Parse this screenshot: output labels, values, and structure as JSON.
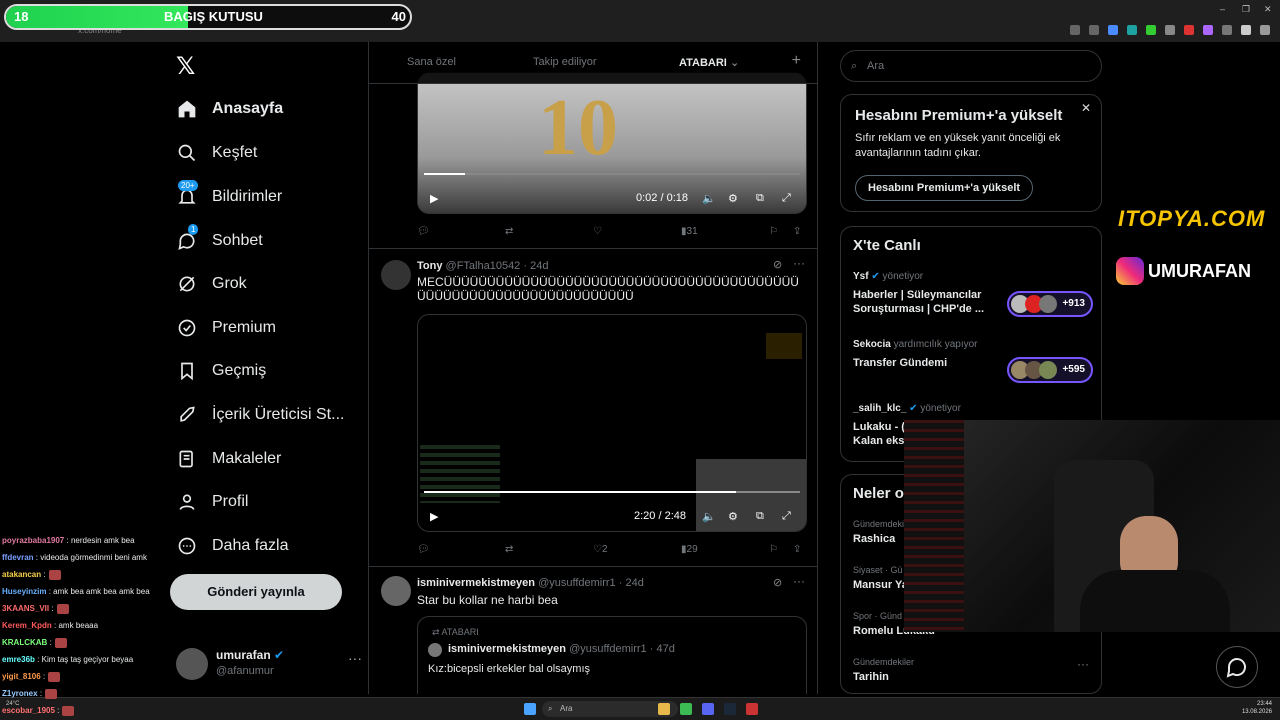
{
  "donation": {
    "left_value": "18",
    "label": "BAGIŞ KUTUSU",
    "right_value": "40",
    "progress_fraction": 0.45
  },
  "browser": {
    "url": "x.com/home"
  },
  "nav": {
    "items": [
      {
        "label": "Anasayfa",
        "icon": "home-icon"
      },
      {
        "label": "Keşfet",
        "icon": "search-icon"
      },
      {
        "label": "Bildirimler",
        "icon": "bell-icon",
        "badge": "20+"
      },
      {
        "label": "Sohbet",
        "icon": "chat-icon",
        "badge": "1"
      },
      {
        "label": "Grok",
        "icon": "grok-icon"
      },
      {
        "label": "Premium",
        "icon": "premium-icon"
      },
      {
        "label": "Geçmiş",
        "icon": "bookmark-icon"
      },
      {
        "label": "İçerik Üreticisi St...",
        "icon": "rocket-icon"
      },
      {
        "label": "Makaleler",
        "icon": "article-icon"
      },
      {
        "label": "Profil",
        "icon": "profile-icon"
      },
      {
        "label": "Daha fazla",
        "icon": "more-icon"
      }
    ],
    "post_button": "Gönderi yayınla",
    "account": {
      "name": "umurafan",
      "handle": "@afanumur"
    }
  },
  "timeline": {
    "tabs": [
      "Sana özel",
      "Takip ediliyor",
      "ATABARI"
    ],
    "tweet1": {
      "video_time": "0:02 / 0:18",
      "video_progress": 0.11,
      "retweets": "",
      "likes": "",
      "views": "31"
    },
    "tweet2": {
      "name": "Tony",
      "handle": "@FTalha10542 · 24d",
      "text": "MECÜÜÜÜÜÜÜÜÜÜÜÜÜÜÜÜÜÜÜÜÜÜÜÜÜÜÜÜÜÜÜÜÜÜÜÜÜÜÜÜÜÜÜÜÜÜÜÜÜÜÜÜÜÜÜÜÜÜÜÜÜÜÜÜÜÜ",
      "video_time": "2:20 / 2:48",
      "video_progress": 0.83,
      "likes": "2",
      "views": "29"
    },
    "tweet3": {
      "name": "isminivermekistmeyen",
      "handle": "@yusuffdemirr1 · 24d",
      "text": "Star bu kollar ne harbi bea",
      "quote_label": "ATABARI",
      "quote_name": "isminivermekistmeyen",
      "quote_handle": "@yusuffdemirr1 · 47d",
      "quote_text": "Kız:bicepsli erkekler bal olsaymış"
    }
  },
  "right": {
    "search_placeholder": "Ara",
    "premium": {
      "title": "Hesabını Premium+'a yükselt",
      "body": "Sıfır reklam ve en yüksek yanıt önceliği ek avantajlarının tadını çıkar.",
      "button": "Hesabını Premium+'a yükselt"
    },
    "live": {
      "title": "X'te Canlı",
      "items": [
        {
          "host": "Ysf",
          "role": "yönetiyor",
          "title": "Haberler | Süleymancılar Soruşturması | CHP'de ...",
          "count": "+913"
        },
        {
          "host": "Sekocia",
          "role": "yardımcılık yapıyor",
          "title": "Transfer Gündemi",
          "count": "+595"
        },
        {
          "host": "_salih_klc_",
          "role": "yönetiyor",
          "title": "Lukaku - ( Kalan eks"
        }
      ]
    },
    "trends": {
      "title": "Neler o",
      "items": [
        {
          "cat": "Gündemdeki",
          "name": "Rashica"
        },
        {
          "cat": "Siyaset · Gü",
          "name": "Mansur Ya"
        },
        {
          "cat": "Spor · Günd",
          "name": "Romelu Lukaku"
        },
        {
          "cat": "Gündemdekiler",
          "name": "Tarihin"
        }
      ]
    }
  },
  "overlays": {
    "brand1": "ITOPYA.COM",
    "brand2": "UMURAFAN"
  },
  "chat": [
    {
      "user": "poyrazbaba1907",
      "msg": ": nerdesin amk bea",
      "color": "#e07aa0"
    },
    {
      "user": "ffdevran",
      "msg": ": videoda görmedinmi beni amk",
      "color": "#7aa0ff"
    },
    {
      "user": "atakancan",
      "msg": ":",
      "color": "#f5d04a"
    },
    {
      "user": "Huseyinzim",
      "msg": ": amk bea amk bea amk bea",
      "color": "#6ab0ff"
    },
    {
      "user": "3KAANS_VII",
      "msg": ":",
      "color": "#ff6a6a"
    },
    {
      "user": "Kerem_Kpdn",
      "msg": ": amk beaaa",
      "color": "#ff5a5a"
    },
    {
      "user": "KRALCKAB",
      "msg": ":",
      "color": "#7cff7c"
    },
    {
      "user": "emre36b",
      "msg": ": Kim taş taş geçiyor beyaa",
      "color": "#6ff"
    },
    {
      "user": "yigit_8106",
      "msg": ":",
      "color": "#ff9a4a"
    },
    {
      "user": "Z1yronex",
      "msg": ":",
      "color": "#9cf"
    },
    {
      "user": "escobar_1905",
      "msg": ":",
      "color": "#ff7070"
    }
  ],
  "taskbar": {
    "search": "Ara",
    "time": "23:44",
    "date": "13.08.2026",
    "weather": "24°C"
  }
}
